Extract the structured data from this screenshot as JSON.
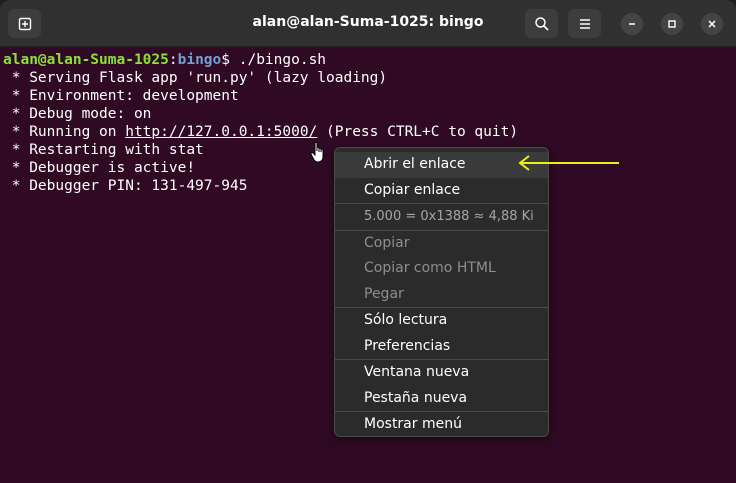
{
  "window": {
    "title": "alan@alan-Suma-1025: bingo",
    "new_tab_icon": "new-tab-icon",
    "search_icon": "search-icon",
    "menu_icon": "hamburger-menu-icon",
    "minimize_icon": "minimize-icon",
    "maximize_icon": "maximize-icon",
    "close_icon": "close-icon"
  },
  "terminal": {
    "prompt_user": "alan@alan-Suma-1025",
    "prompt_sep": ":",
    "prompt_path": "bingo",
    "prompt_symbol": "$",
    "command": " ./bingo.sh",
    "lines": [
      " * Serving Flask app 'run.py' (lazy loading)",
      " * Environment: development",
      " * Debug mode: on"
    ],
    "running_prefix": " * Running on ",
    "running_url": "http://127.0.0.1:5000/",
    "running_suffix": " (Press CTRL+C to quit)",
    "lines_after": [
      " * Restarting with stat",
      " * Debugger is active!",
      " * Debugger PIN: 131-497-945"
    ]
  },
  "context_menu": {
    "open_link": "Abrir el enlace",
    "copy_link": "Copiar enlace",
    "number_info": "5.000 = 0x1388 ≈ 4,88 Ki",
    "copy": "Copiar",
    "copy_html": "Copiar como HTML",
    "paste": "Pegar",
    "read_only": "Sólo lectura",
    "preferences": "Preferencias",
    "new_window": "Ventana nueva",
    "new_tab": "Pestaña nueva",
    "show_menu": "Mostrar menú"
  },
  "colors": {
    "terminal_bg": "#300a24",
    "prompt_user": "#8ae234",
    "prompt_path": "#729fcf",
    "annotation_arrow": "#e5f21a"
  }
}
